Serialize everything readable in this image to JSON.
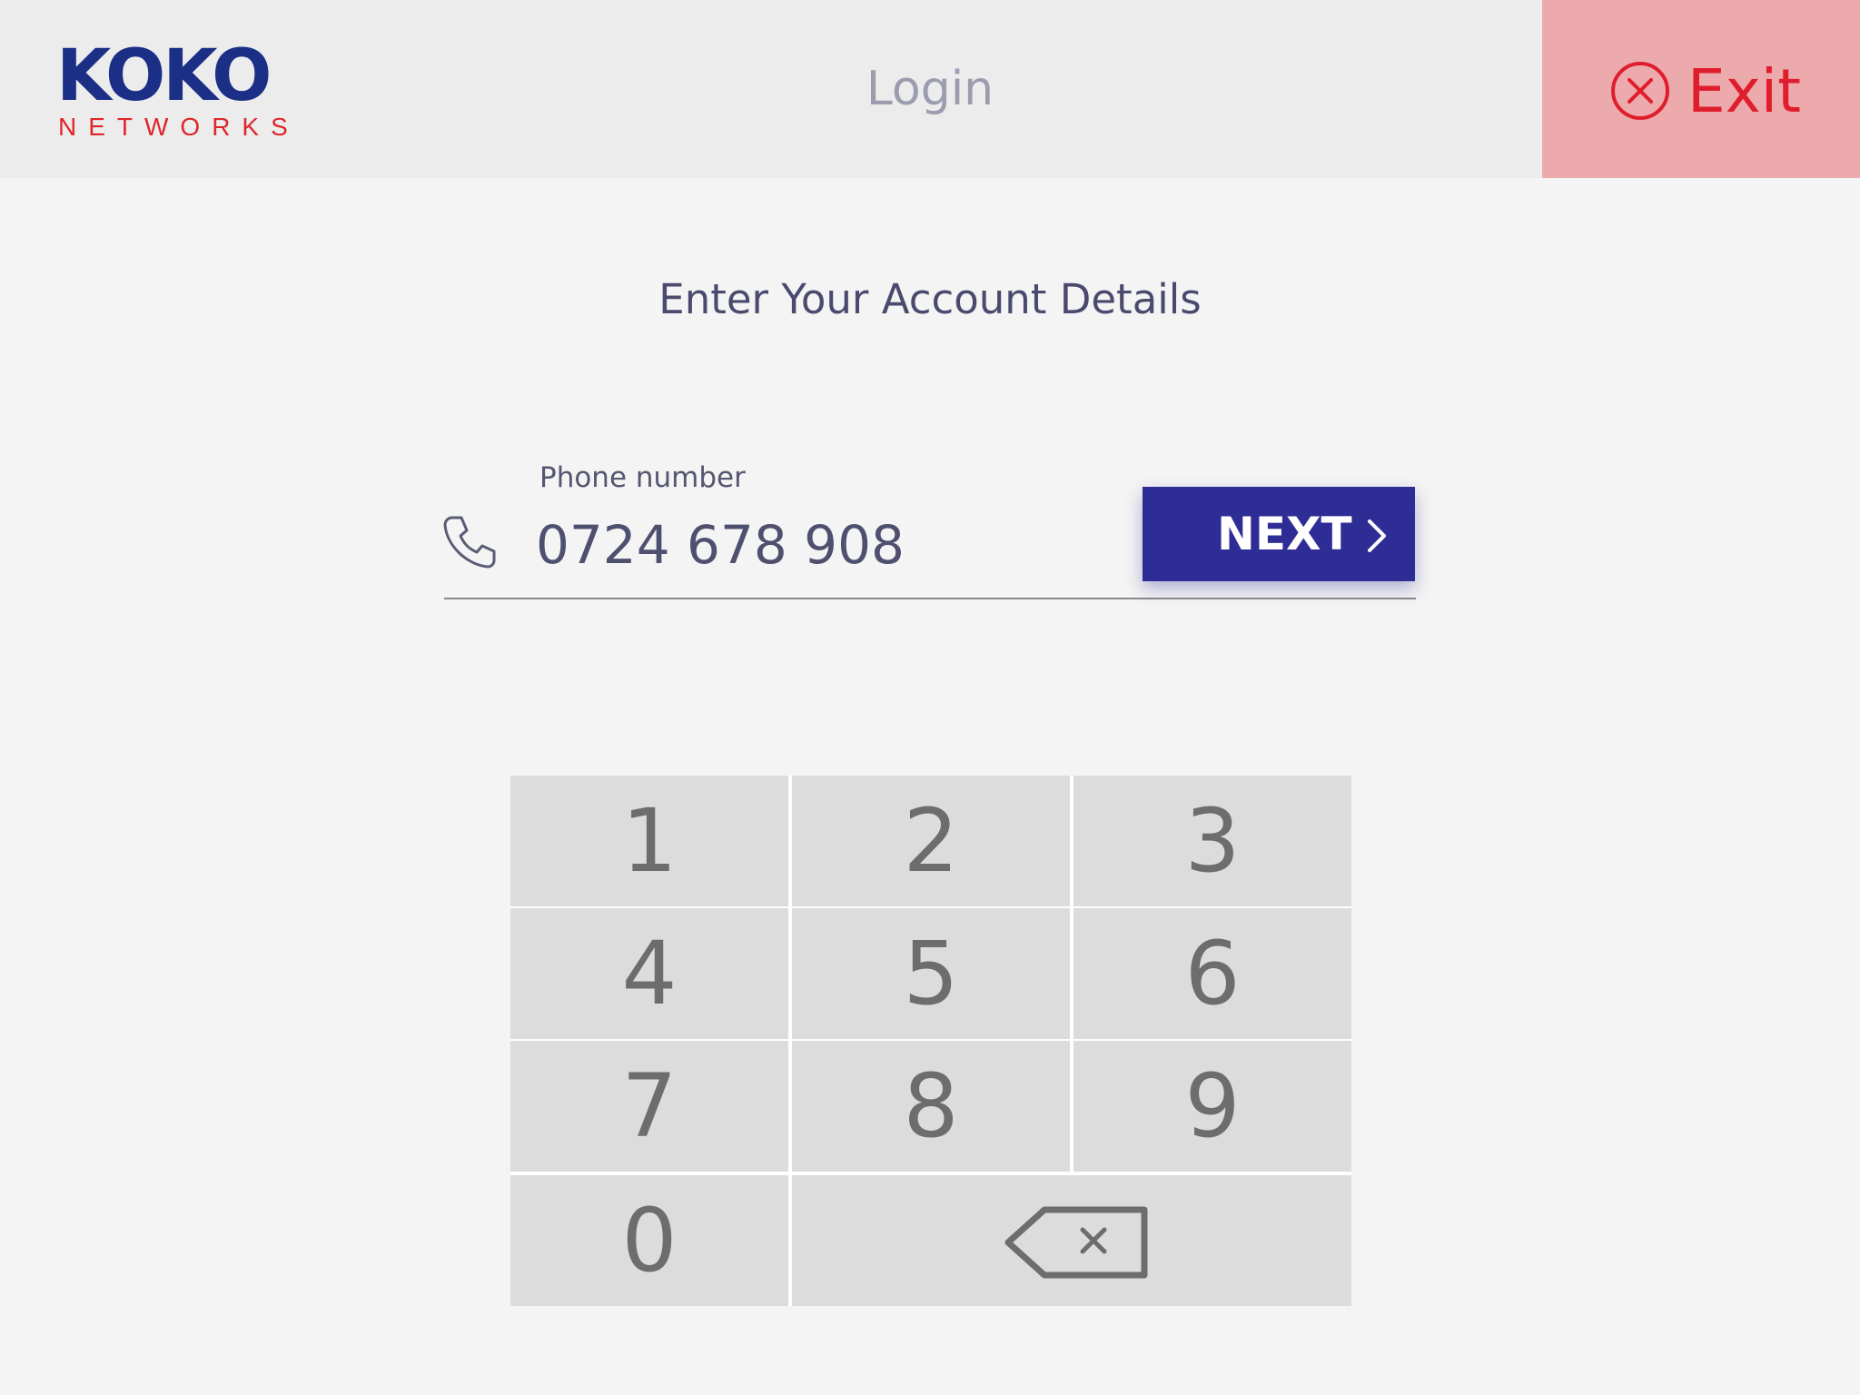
{
  "header": {
    "logo_main": "KOKO",
    "logo_sub": "NETWORKS",
    "title": "Login",
    "exit_label": "Exit",
    "exit_icon": "close-circle-icon"
  },
  "main": {
    "heading": "Enter Your Account Details",
    "phone_field": {
      "label": "Phone number",
      "value": "0724 678 908",
      "icon": "phone-icon"
    },
    "next_button": {
      "label": "NEXT",
      "icon": "chevron-right-icon"
    }
  },
  "keypad": {
    "keys": [
      "1",
      "2",
      "3",
      "4",
      "5",
      "6",
      "7",
      "8",
      "9",
      "0"
    ],
    "backspace_icon": "backspace-icon"
  },
  "colors": {
    "brand_blue": "#1b2f86",
    "brand_red": "#e0262b",
    "next_button_bg": "#2e2d96",
    "exit_bg": "#ecaaad",
    "exit_text": "#e01d2c",
    "key_bg": "#dcdcdc"
  }
}
